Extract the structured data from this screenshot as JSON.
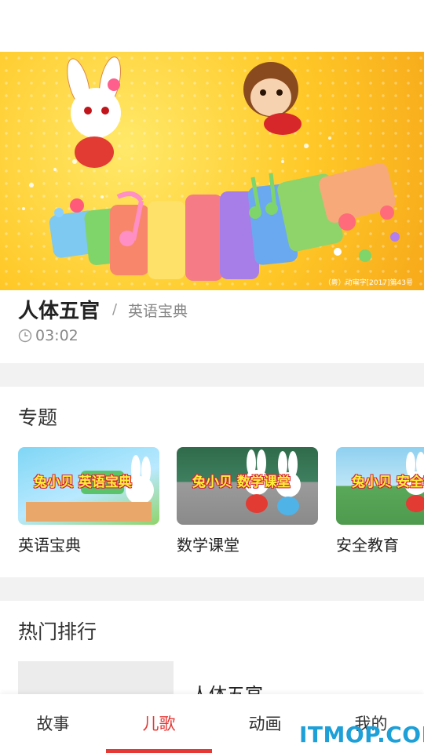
{
  "hero": {
    "copyright": "（粤）动审字[2017]第43号"
  },
  "detail": {
    "title": "人体五官",
    "separator": "/",
    "album": "英语宝典",
    "duration": "03:02"
  },
  "topics": {
    "heading": "专题",
    "items": [
      {
        "label": "英语宝典",
        "thumb_text": "兔小贝 英语宝典"
      },
      {
        "label": "数学课堂",
        "thumb_text": "兔小贝 数学课堂"
      },
      {
        "label": "安全教育",
        "thumb_text": "兔小贝 安全教育"
      }
    ]
  },
  "hot": {
    "heading": "热门排行",
    "items": [
      {
        "name": "人体五官"
      }
    ]
  },
  "tabs": [
    {
      "label": "故事"
    },
    {
      "label": "儿歌"
    },
    {
      "label": "动画"
    },
    {
      "label": "我的"
    }
  ],
  "active_tab": "儿歌",
  "accent_color": "#e53935",
  "watermark": "ITMOP.COM"
}
